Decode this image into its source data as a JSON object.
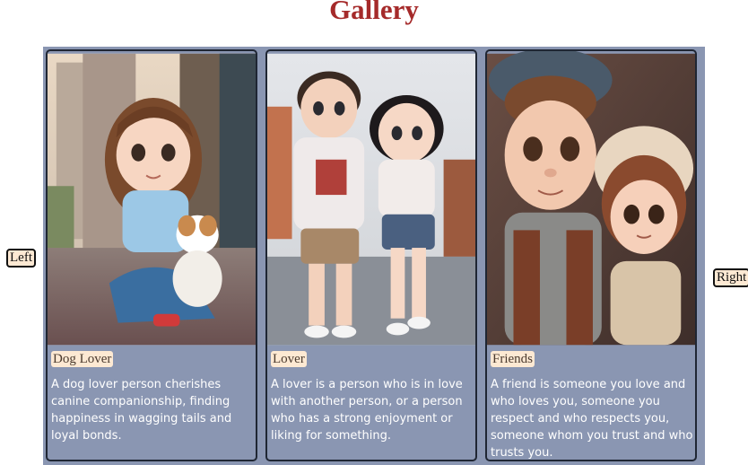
{
  "header": {
    "title": "Gallery"
  },
  "nav": {
    "left_label": "Left",
    "right_label": "Right"
  },
  "cards": [
    {
      "label": "Dog Lover",
      "image": "illustration-girl-with-dog",
      "description": "A dog lover person cherishes canine companionship, finding happiness in wagging tails and loyal bonds."
    },
    {
      "label": "Lover",
      "image": "illustration-couple-holding-hands",
      "description": "A lover is a person who is in love with another person, or a person who has a strong enjoyment or liking for something."
    },
    {
      "label": "Friends",
      "image": "illustration-boy-and-girl-friends",
      "description": "A friend is someone you love and who loves you, someone you respect and who respects you, someone whom you trust and who trusts you."
    }
  ],
  "colors": {
    "title": "#a52a2a",
    "gallery_bg": "#8a96b2",
    "label_bg": "#fde9d3",
    "card_border": "#1f2633"
  }
}
